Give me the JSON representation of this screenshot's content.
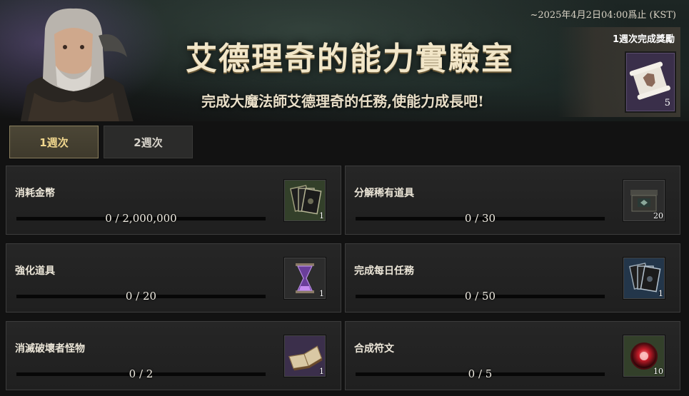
{
  "event": {
    "deadline": "~2025年4月2日04:00爲止 (KST)",
    "title": "艾德理奇的能力實驗室",
    "subtitle": "完成大魔法師艾德理奇的任務,使能力成長吧!"
  },
  "weekly_reward": {
    "label": "1週次完成獎勵",
    "count": "5",
    "icon": "scroll-icon"
  },
  "tabs": [
    {
      "label": "1週次",
      "active": true
    },
    {
      "label": "2週次",
      "active": false
    }
  ],
  "missions": [
    {
      "label": "消耗金幣",
      "progress": "0 / 2,000,000",
      "fraction": 0,
      "reward_count": "1",
      "reward_icon": "card-pack-icon"
    },
    {
      "label": "分解稀有道具",
      "progress": "0 / 30",
      "fraction": 0,
      "reward_count": "20",
      "reward_icon": "chest-icon"
    },
    {
      "label": "強化道具",
      "progress": "0 / 20",
      "fraction": 0,
      "reward_count": "1",
      "reward_icon": "hourglass-icon"
    },
    {
      "label": "完成每日任務",
      "progress": "0 / 50",
      "fraction": 0,
      "reward_count": "1",
      "reward_icon": "card-pack-icon"
    },
    {
      "label": "消滅破壞者怪物",
      "progress": "0 / 2",
      "fraction": 0,
      "reward_count": "1",
      "reward_icon": "book-icon"
    },
    {
      "label": "合成符文",
      "progress": "0 / 5",
      "fraction": 0,
      "reward_count": "10",
      "reward_icon": "rune-orb-icon"
    }
  ],
  "colors": {
    "accent_gold": "#f1d78e",
    "progress_fill": "#c9a860"
  }
}
